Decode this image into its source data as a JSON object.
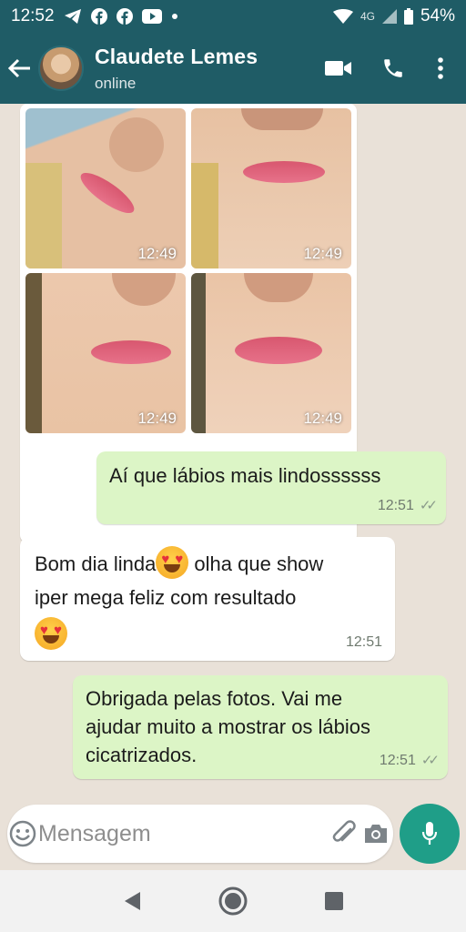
{
  "status_bar": {
    "time": "12:52",
    "network": "4G",
    "battery": "54%"
  },
  "header": {
    "contact_name": "Claudete Lemes",
    "contact_status": "online",
    "colors": {
      "header_bg": "#1f5c66"
    }
  },
  "chat": {
    "photos": [
      {
        "time": "12:49"
      },
      {
        "time": "12:49"
      },
      {
        "time": "12:49"
      },
      {
        "time": "12:49"
      }
    ],
    "messages": [
      {
        "direction": "outgoing",
        "text": "Aí que lábios mais lindossssss",
        "time": "12:51",
        "status": "read"
      },
      {
        "direction": "incoming",
        "line1": "Bom dia linda",
        "line1b": " olha que show",
        "line2": "iper mega feliz  com resultado",
        "time": "12:51"
      },
      {
        "direction": "outgoing",
        "text": "Obrigada pelas fotos. Vai me ajudar muito a mostrar os lábios cicatrizados.",
        "time": "12:51",
        "status": "read"
      }
    ]
  },
  "composer": {
    "placeholder": "Mensagem"
  },
  "colors": {
    "outgoing_bubble": "#dcf5c6",
    "incoming_bubble": "#ffffff",
    "mic_button": "#1f9e88",
    "chat_bg": "#e9e1d8"
  }
}
